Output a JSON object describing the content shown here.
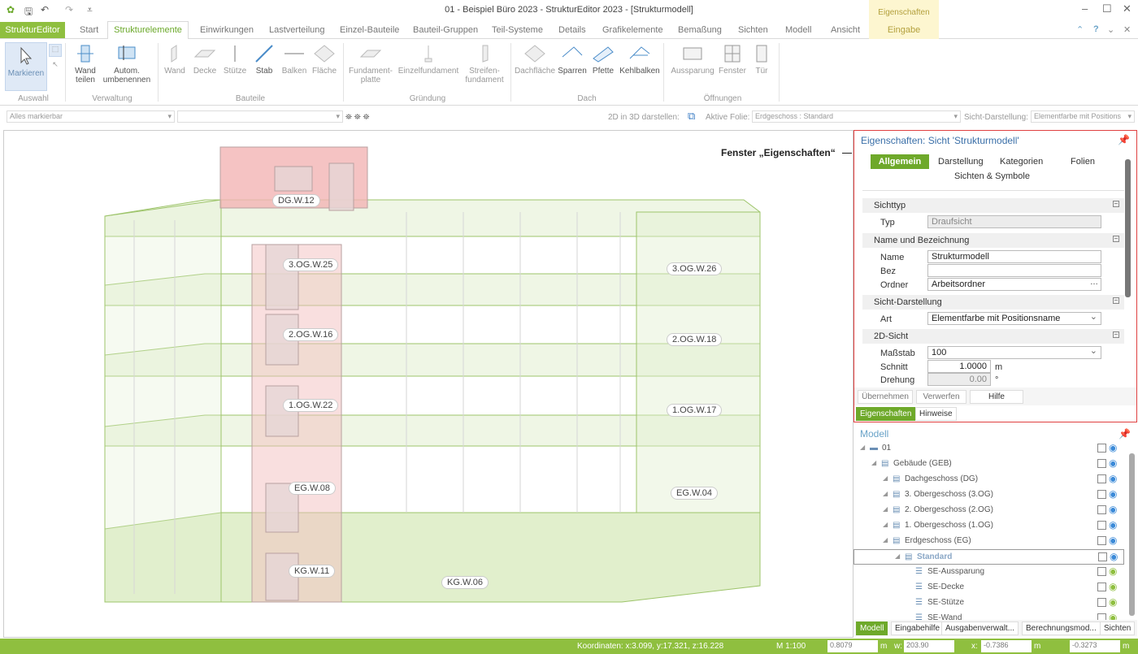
{
  "window": {
    "title": "01 - Beispiel Büro 2023 - StrukturEditor 2023 - [Strukturmodell]",
    "context_header": "Eigenschaften"
  },
  "ribbon": {
    "file_tab": "StrukturEditor",
    "tabs": [
      "Start",
      "Strukturelemente",
      "Einwirkungen",
      "Lastverteilung",
      "Einzel-Bauteile",
      "Bauteil-Gruppen",
      "Teil-Systeme",
      "Details",
      "Grafikelemente",
      "Bemaßung",
      "Sichten",
      "Modell",
      "Ansicht"
    ],
    "active_tab": "Strukturelemente",
    "context_tab": "Eingabe",
    "buttons": {
      "markieren": "Markieren",
      "wand_teilen": "Wand teilen",
      "autom_umbenennen": "Autom. umbenennen",
      "wand": "Wand",
      "decke": "Decke",
      "stuetze": "Stütze",
      "stab": "Stab",
      "balken": "Balken",
      "flaeche": "Fläche",
      "fundamentplatte": "Fundament-platte",
      "einzelfundament": "Einzelfundament",
      "streifenfundament": "Streifen-fundament",
      "dachflaeche": "Dachfläche",
      "sparren": "Sparren",
      "pfette": "Pfette",
      "kehlbalken": "Kehlbalken",
      "aussparung": "Aussparung",
      "fenster": "Fenster",
      "tuer": "Tür"
    },
    "groups": {
      "auswahl": "Auswahl",
      "verwaltung": "Verwaltung",
      "bauteile": "Bauteile",
      "gruendung": "Gründung",
      "dach": "Dach",
      "oeffnungen": "Öffnungen"
    }
  },
  "selection_bar": {
    "filter": "Alles markierbar",
    "second": "",
    "label_2d3d": "2D in 3D darstellen:",
    "label_folie": "Aktive Folie:",
    "folie_value": "Erdgeschoss : Standard",
    "label_sicht": "Sicht-Darstellung:",
    "sicht_value": "Elementfarbe mit Positions"
  },
  "viewport": {
    "annotation": "Fenster „Eigenschaften“",
    "labels": [
      "DG.W.12",
      "3.OG.W.25",
      "3.OG.W.26",
      "2.OG.W.16",
      "2.OG.W.18",
      "1.OG.W.22",
      "1.OG.W.17",
      "EG.W.08",
      "EG.W.04",
      "KG.W.11",
      "KG.W.06"
    ]
  },
  "properties": {
    "title": "Eigenschaften: Sicht 'Strukturmodell'",
    "tabs": [
      "Allgemein",
      "Darstellung",
      "Kategorien",
      "Folien",
      "Sichten & Symbole"
    ],
    "sections": {
      "sichttyp": "Sichttyp",
      "name_bez": "Name und Bezeichnung",
      "sicht_darstellung": "Sicht-Darstellung",
      "sicht_2d": "2D-Sicht"
    },
    "fields": {
      "typ_label": "Typ",
      "typ_value": "Draufsicht",
      "name_label": "Name",
      "name_value": "Strukturmodell",
      "bez_label": "Bez",
      "bez_value": "",
      "ordner_label": "Ordner",
      "ordner_value": "Arbeitsordner",
      "art_label": "Art",
      "art_value": "Elementfarbe mit Positionsname",
      "massstab_label": "Maßstab",
      "massstab_value": "100",
      "schnitt_label": "Schnitt",
      "schnitt_value": "1.0000",
      "schnitt_unit": "m",
      "drehung_label": "Drehung",
      "drehung_value": "0.00",
      "drehung_unit": "°"
    },
    "buttons": {
      "uebernehmen": "Übernehmen",
      "verwerfen": "Verwerfen",
      "hilfe": "Hilfe"
    },
    "bottom_tabs": [
      "Eigenschaften",
      "Hinweise"
    ]
  },
  "model": {
    "title": "Modell",
    "tree": [
      "01",
      "Gebäude (GEB)",
      "Dachgeschoss (DG)",
      "3. Obergeschoss (3.OG)",
      "2. Obergeschoss (2.OG)",
      "1. Obergeschoss (1.OG)",
      "Erdgeschoss (EG)",
      "Standard",
      "SE-Aussparung",
      "SE-Decke",
      "SE-Stütze",
      "SE-Wand"
    ],
    "bottom_tabs": [
      "Modell",
      "Eingabehilfe",
      "Ausgabenverwalt...",
      "Berechnungsmod...",
      "Sichten"
    ]
  },
  "status": {
    "koordinaten": "Koordinaten: x:3.099, y:17.321, z:16.228",
    "massstab": "M 1:100",
    "h_value": "0.8079",
    "w_label": "w:",
    "w_value": "203.90",
    "x_label": "x:",
    "x_value": "-0.7386",
    "y_value": "-0.3273",
    "unit": "m"
  },
  "colors": {
    "accent": "#8fbf3f",
    "props_border": "#e04040",
    "link": "#3a6fa8"
  }
}
